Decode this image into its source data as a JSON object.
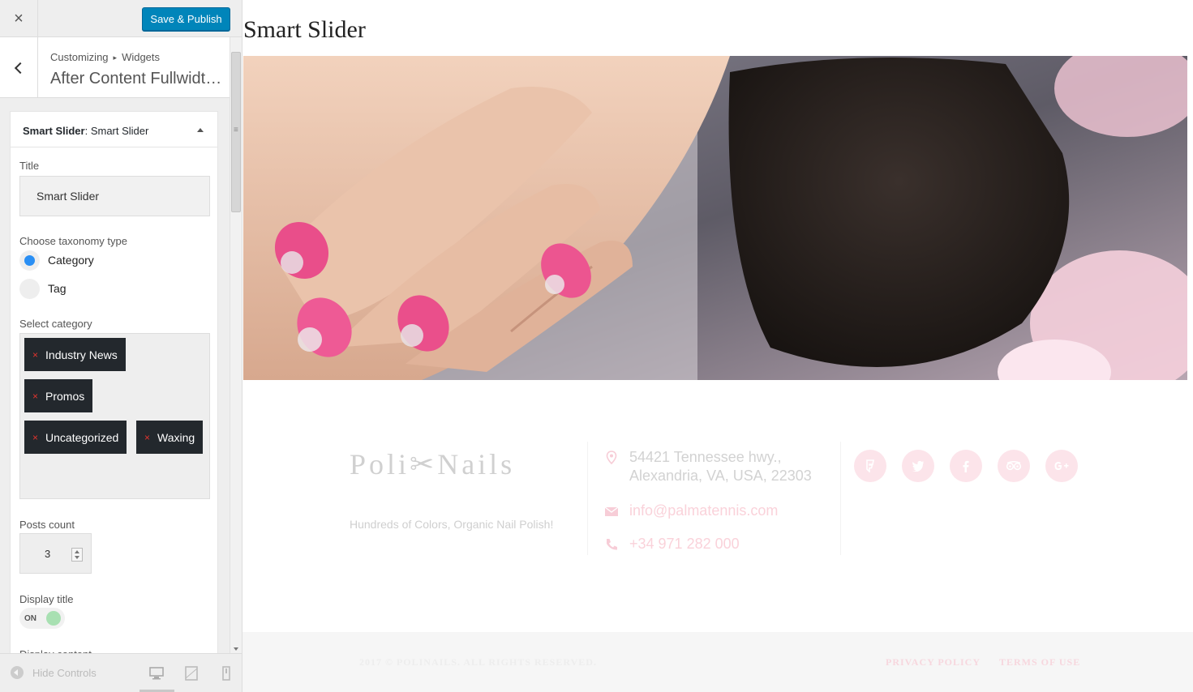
{
  "topbar": {
    "close_icon": "×",
    "save_label": "Save & Publish"
  },
  "section": {
    "breadcrumb_root": "Customizing",
    "breadcrumb_sep": "▸",
    "breadcrumb_leaf": "Widgets",
    "title": "After Content Fullwidth..."
  },
  "widget": {
    "name_bold": "Smart Slider",
    "name_rest": ": Smart Slider",
    "title_label": "Title",
    "title_value": "Smart Slider",
    "taxonomy_label": "Choose taxonomy type",
    "taxonomy_options": [
      {
        "label": "Category",
        "selected": true
      },
      {
        "label": "Tag",
        "selected": false
      }
    ],
    "category_label": "Select category",
    "categories": [
      "Industry News",
      "Promos",
      "Uncategorized",
      "Waxing"
    ],
    "remove_glyph": "×",
    "posts_count_label": "Posts count",
    "posts_count": "3",
    "display_title_label": "Display title",
    "display_title_state": "ON",
    "display_content_label": "Display content"
  },
  "footer_controls": {
    "hide_label": "Hide Controls"
  },
  "preview": {
    "widget_title": "Smart Slider",
    "logo": "Poli✂Nails",
    "tagline": "Hundreds of Colors, Organic Nail Polish!",
    "address_line1": "54421 Tennessee hwy.,",
    "address_line2": "Alexandria, VA, USA, 22303",
    "email": "info@palmatennis.com",
    "phone": "+34 971 282 000",
    "social_icons": [
      "foursquare-icon",
      "twitter-icon",
      "facebook-icon",
      "tripadvisor-icon",
      "google-plus-icon"
    ],
    "copyright": "2017 © POLINAILS. ALL RIGHTS RESERVED.",
    "links": [
      "PRIVACY POLICY",
      "TERMS OF USE"
    ]
  },
  "colors": {
    "primary_button": "#0085ba",
    "tag_bg": "#23282d",
    "tag_remove": "#e2342e",
    "radio_on": "#2a8ff4",
    "toggle_on": "#a8e0b2",
    "accent_pink": "#fce4ea"
  }
}
